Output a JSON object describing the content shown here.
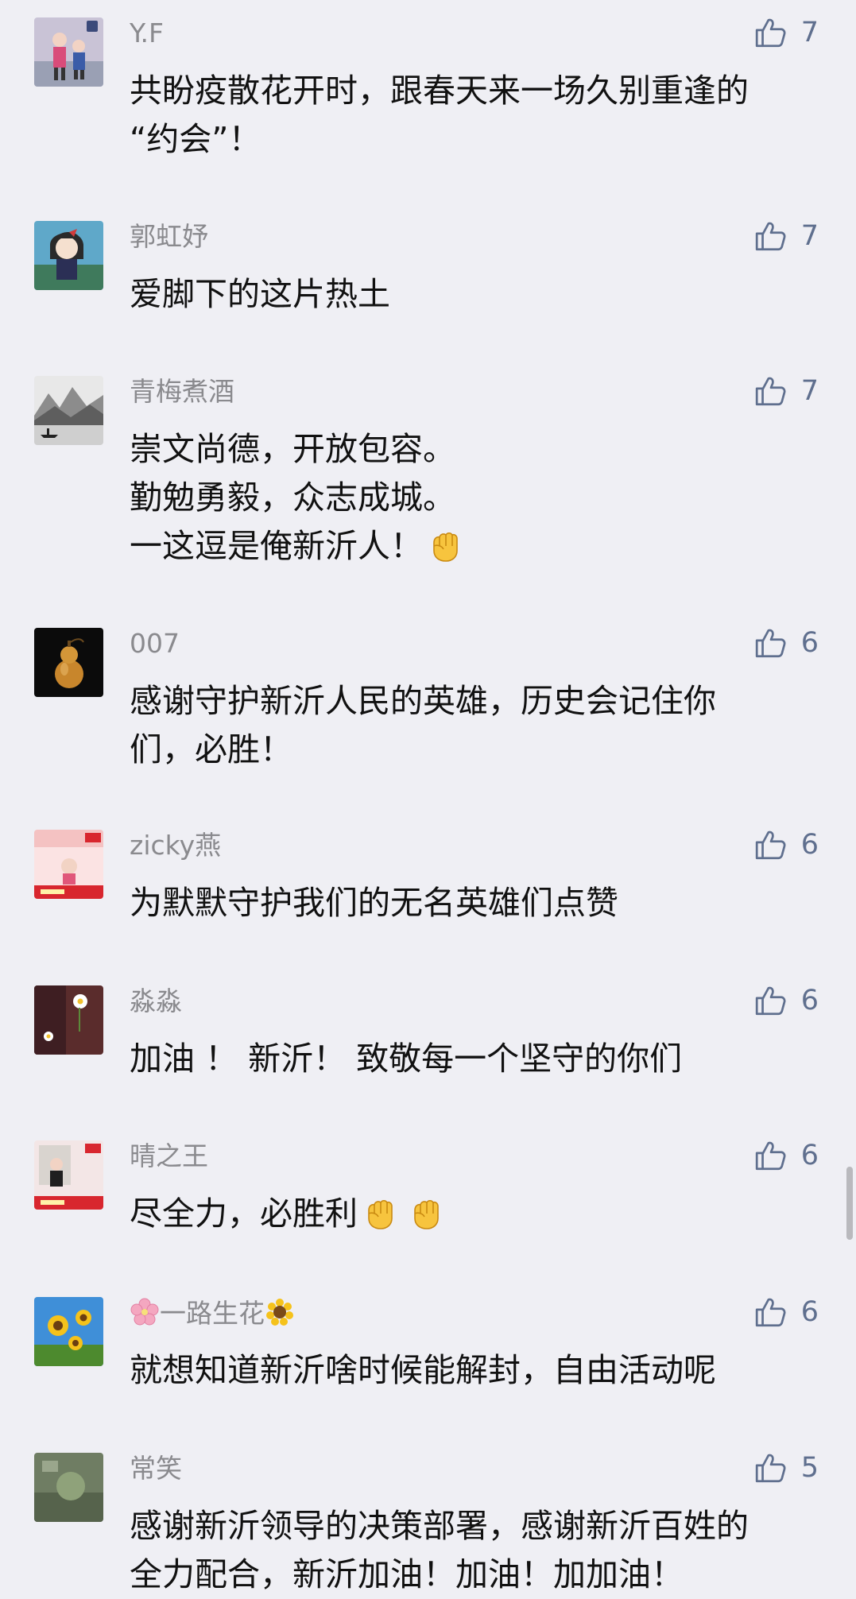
{
  "comments": [
    {
      "name": "Y.F",
      "likes": "7",
      "avatar_icon": "girls-avatar-icon",
      "lines": [
        "共盼疫散花开时，跟春天来一场久别重逢的",
        "“约会”！"
      ]
    },
    {
      "name": "郭虹妤",
      "likes": "7",
      "avatar_icon": "cartoon-girl-avatar-icon",
      "lines": [
        "爱脚下的这片热土"
      ]
    },
    {
      "name": "青梅煮酒",
      "likes": "7",
      "avatar_icon": "ink-landscape-avatar-icon",
      "lines": [
        "崇文尚德，开放包容。",
        "勤勉勇毅，众志成城。",
        "一这逗是俺新沂人！"
      ]
    },
    {
      "name": "007",
      "likes": "6",
      "avatar_icon": "gourd-avatar-icon",
      "lines": [
        "感谢守护新沂人民的英雄，历史会记住你",
        "们，必胜！"
      ]
    },
    {
      "name": "zicky燕",
      "likes": "6",
      "avatar_icon": "red-poster-avatar-icon",
      "lines": [
        "为默默守护我们的无名英雄们点赞"
      ]
    },
    {
      "name": "淼淼",
      "likes": "6",
      "avatar_icon": "daisy-avatar-icon",
      "lines": [
        "加油 ！ 新沂！ 致敬每一个坚守的你们"
      ]
    },
    {
      "name": "晴之王",
      "likes": "6",
      "avatar_icon": "red-poster-avatar-icon",
      "lines": [
        "尽全力，必胜利"
      ]
    },
    {
      "name": "一路生花",
      "likes": "6",
      "avatar_icon": "sunflower-avatar-icon",
      "lines": [
        "就想知道新沂啥时候能解封，自由活动呢"
      ]
    },
    {
      "name": "常笑",
      "likes": "5",
      "avatar_icon": "green-photo-avatar-icon",
      "lines": [
        "感谢新沂领导的决策部署，感谢新沂百姓的",
        "全力配合，新沂加油！加油！加加油！"
      ]
    }
  ],
  "icons": {
    "like": "thumbs-up-icon",
    "fist": "raised-fist-emoji-icon",
    "flower_before_name": "cherry-blossom-emoji-icon",
    "flower_after_name": "sunflower-emoji-icon"
  },
  "colors": {
    "background": "#efeff4",
    "name": "#8a8a8e",
    "like": "#5f6f8e",
    "text": "#111111"
  }
}
